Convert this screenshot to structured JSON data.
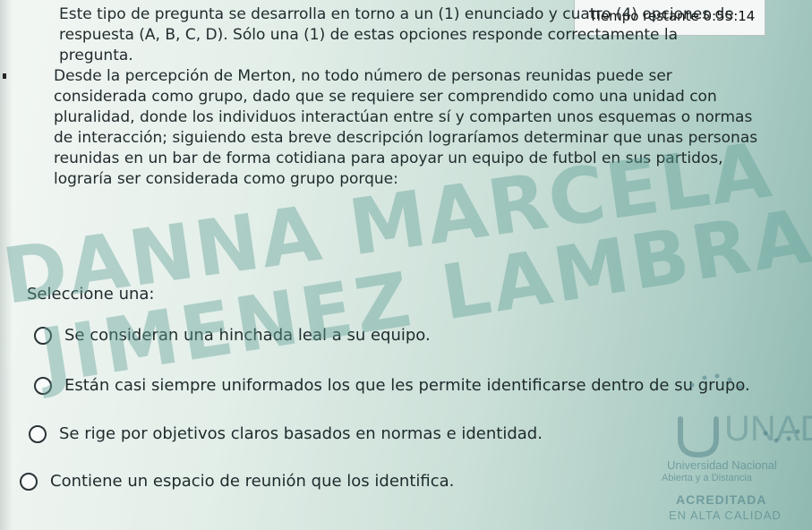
{
  "timer": {
    "label": "Tiempo restante 0:55:14"
  },
  "instructions": "Este tipo de pregunta se desarrolla en torno a un (1) enunciado y cuatro (4) opciones de respuesta (A, B, C, D). Sólo una (1) de estas opciones responde correctamente la pregunta.",
  "question": "Desde la percepción de Merton, no todo número de personas reunidas puede ser considerada como grupo, dado que se requiere ser comprendido como una unidad con pluralidad, donde los individuos interactúan entre sí y comparten unos esquemas o normas de interacción; siguiendo esta breve descripción lograríamos determinar que unas personas reunidas en un bar de forma cotidiana para apoyar un equipo de futbol en sus partidos, lograría ser considerada como grupo porque:",
  "select_label": "Seleccione una:",
  "options": [
    {
      "text": "Se consideran una hinchada leal a su equipo.",
      "selected": false
    },
    {
      "text": "Están casi siempre uniformados los que les permite identificarse dentro de su grupo.",
      "selected": false
    },
    {
      "text": "Se rige por objetivos claros basados en normas e identidad.",
      "selected": false
    },
    {
      "text": "Contiene un espacio de reunión que los identifica.",
      "selected": false
    }
  ],
  "watermark": {
    "line1": "DANNA MARCELA",
    "line2": "JIMENEZ LAMBRANO"
  },
  "logo": {
    "mark": "UNAD",
    "line1": "Universidad Nacional",
    "line2": "Abierta y a Distancia",
    "line3": "ACREDITADA",
    "line4": "EN ALTA CALIDAD"
  }
}
